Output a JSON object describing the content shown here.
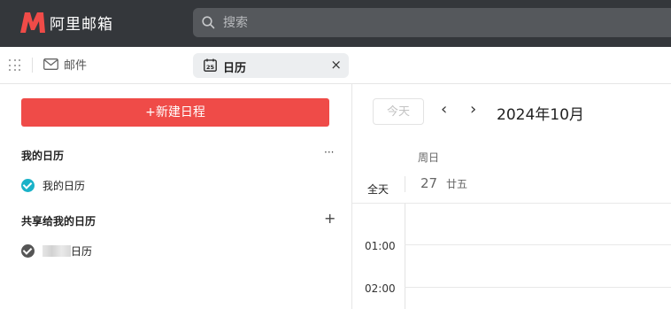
{
  "app": {
    "logo_text": "阿里邮箱",
    "brand_color": "#ef4b48",
    "search_placeholder": "搜索"
  },
  "tabs": {
    "mail_label": "邮件",
    "calendar_label": "日历",
    "calendar_icon_day": "25",
    "close_glyph": "×"
  },
  "sidebar": {
    "new_event_label": "+新建日程",
    "my_calendars": {
      "title": "我的日历",
      "action": "···",
      "items": [
        {
          "label": "我的日历",
          "color": "#1ab2c8"
        }
      ]
    },
    "shared_calendars": {
      "title": "共享给我的日历",
      "action": "+",
      "items": [
        {
          "label": "日历",
          "color": "#555555"
        }
      ]
    }
  },
  "calendar": {
    "today_button": "今天",
    "prev_glyph": "‹",
    "next_glyph": "›",
    "month_label": "2024年10月",
    "day_of_week": "周日",
    "date_number": "27",
    "lunar_date": "廿五",
    "all_day_label": "全天",
    "hours": [
      "01:00",
      "02:00"
    ]
  }
}
